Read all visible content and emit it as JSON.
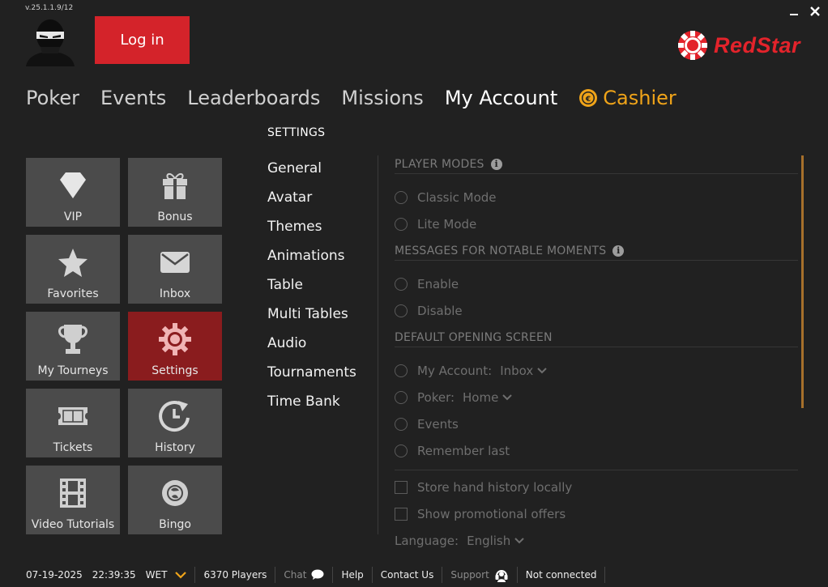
{
  "version": "v.25.1.1.9/12",
  "brand": {
    "name": "RedStar",
    "color": "#e3232b"
  },
  "header": {
    "login_label": "Log in"
  },
  "nav": {
    "items": [
      {
        "label": "Poker"
      },
      {
        "label": "Events"
      },
      {
        "label": "Leaderboards"
      },
      {
        "label": "Missions"
      },
      {
        "label": "My Account",
        "active": true
      },
      {
        "label": "Cashier",
        "icon": "cashier-chip-icon",
        "color": "#f0a419"
      }
    ]
  },
  "account_tiles": [
    {
      "label": "VIP",
      "icon": "diamond-icon"
    },
    {
      "label": "Bonus",
      "icon": "gift-icon"
    },
    {
      "label": "Favorites",
      "icon": "star-icon"
    },
    {
      "label": "Inbox",
      "icon": "envelope-icon"
    },
    {
      "label": "My Tourneys",
      "icon": "trophy-icon"
    },
    {
      "label": "Settings",
      "icon": "gear-icon",
      "active": true
    },
    {
      "label": "Tickets",
      "icon": "ticket-icon"
    },
    {
      "label": "History",
      "icon": "history-icon"
    },
    {
      "label": "Video Tutorials",
      "icon": "film-icon"
    },
    {
      "label": "Bingo",
      "icon": "bingo-icon"
    }
  ],
  "settings": {
    "heading": "SETTINGS",
    "menu": [
      "General",
      "Avatar",
      "Themes",
      "Animations",
      "Table",
      "Multi Tables",
      "Audio",
      "Tournaments",
      "Time Bank"
    ],
    "player_modes": {
      "title": "PLAYER MODES",
      "options": [
        "Classic Mode",
        "Lite Mode"
      ]
    },
    "notable_moments": {
      "title": "MESSAGES FOR NOTABLE MOMENTS",
      "options": [
        "Enable",
        "Disable"
      ]
    },
    "opening_screen": {
      "title": "DEFAULT OPENING SCREEN",
      "my_account": {
        "label": "My Account:",
        "value": "Inbox"
      },
      "poker": {
        "label": "Poker:",
        "value": "Home"
      },
      "events": "Events",
      "remember": "Remember last"
    },
    "checkboxes": [
      "Store hand history locally",
      "Show promotional offers"
    ],
    "language": {
      "label": "Language:",
      "value": "English"
    }
  },
  "status_bar": {
    "date": "07-19-2025",
    "time": "22:39:35",
    "timezone": "WET",
    "players": "6370 Players",
    "chat": "Chat",
    "help": "Help",
    "contact": "Contact Us",
    "support": "Support",
    "connection": "Not connected"
  }
}
